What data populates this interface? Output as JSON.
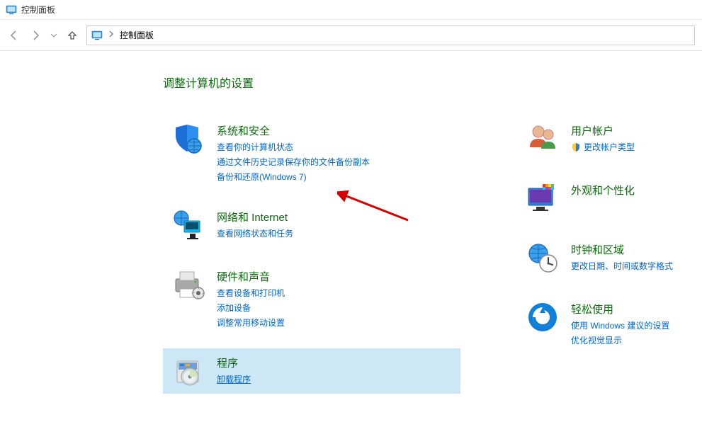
{
  "titlebar": {
    "title": "控制面板"
  },
  "breadcrumb": {
    "root": "控制面板"
  },
  "page": {
    "heading": "调整计算机的设置"
  },
  "left": [
    {
      "title": "系统和安全",
      "links": [
        {
          "label": "查看你的计算机状态"
        },
        {
          "label": "通过文件历史记录保存你的文件备份副本"
        },
        {
          "label": "备份和还原(Windows 7)"
        }
      ]
    },
    {
      "title": "网络和 Internet",
      "links": [
        {
          "label": "查看网络状态和任务"
        }
      ]
    },
    {
      "title": "硬件和声音",
      "links": [
        {
          "label": "查看设备和打印机"
        },
        {
          "label": "添加设备"
        },
        {
          "label": "调整常用移动设置"
        }
      ]
    },
    {
      "title": "程序",
      "links": [
        {
          "label": "卸载程序"
        }
      ]
    }
  ],
  "right": [
    {
      "title": "用户帐户",
      "links": [
        {
          "label": "更改帐户类型",
          "shield": true
        }
      ]
    },
    {
      "title": "外观和个性化",
      "links": []
    },
    {
      "title": "时钟和区域",
      "links": [
        {
          "label": "更改日期、时间或数字格式"
        }
      ]
    },
    {
      "title": "轻松使用",
      "links": [
        {
          "label": "使用 Windows 建议的设置"
        },
        {
          "label": "优化视觉显示"
        }
      ]
    }
  ]
}
